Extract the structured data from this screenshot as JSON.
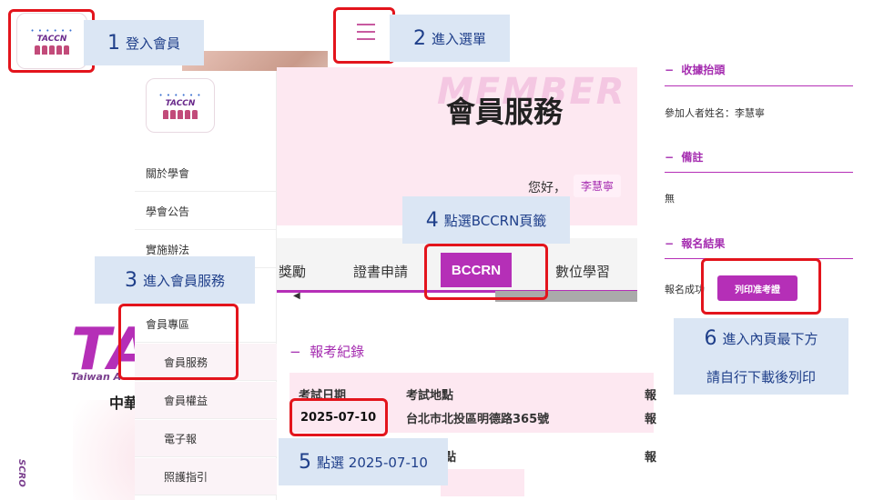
{
  "background": {
    "brand_big": "TA",
    "brand_sub": "Taiwan A",
    "brand_zh": "中華",
    "scroll_text": "SCRO"
  },
  "logo": {
    "text": "TACCN"
  },
  "sidebar": {
    "items": [
      {
        "label": "關於學會"
      },
      {
        "label": "學會公告"
      },
      {
        "label": "實施辦法"
      },
      {
        "label": "會員專區"
      },
      {
        "label": "會員服務"
      },
      {
        "label": "會員權益"
      },
      {
        "label": "電子報"
      },
      {
        "label": "照護指引"
      }
    ]
  },
  "member_panel": {
    "ghost_text": "MEMBER",
    "title": "會員服務",
    "greeting": "您好，",
    "user_name": "李慧寧",
    "tabs": [
      {
        "label": "獎勵"
      },
      {
        "label": "證書申請"
      },
      {
        "label": "BCCRN"
      },
      {
        "label": "數位學習"
      }
    ],
    "scroll_left": "◀"
  },
  "records": {
    "section_title": "報考紀錄",
    "header_date": "考試日期",
    "header_location": "考試地點",
    "header_more": "報",
    "row_date": "2025-07-10",
    "row_location": "台北市北投區明德路365號",
    "row_more": "報",
    "row2_location_tail": "點",
    "row2_more": "報"
  },
  "right_panel": {
    "receipt_title": "收據抬頭",
    "receipt_name": "參加人者姓名：李慧寧",
    "note_title": "備註",
    "note_value": "無",
    "result_title": "報名結果",
    "result_value": "報名成功",
    "print_button": "列印准考證"
  },
  "callouts": {
    "c1": {
      "num": "1",
      "text": "登入會員"
    },
    "c2": {
      "num": "2",
      "text": "進入選單"
    },
    "c3": {
      "num": "3",
      "text": "進入會員服務"
    },
    "c4": {
      "num": "4",
      "text": "點選BCCRN頁籤"
    },
    "c5": {
      "num": "5",
      "text": "點選 2025-07-10"
    },
    "c6": {
      "num": "6",
      "text": "進入內頁最下方"
    },
    "c6b": {
      "text": "請自行下載後列印"
    }
  },
  "colors": {
    "accent": "#b52fb7",
    "callout_bg": "#dbe6f4",
    "callout_text": "#1f3f8a",
    "highlight": "#e3141c"
  }
}
